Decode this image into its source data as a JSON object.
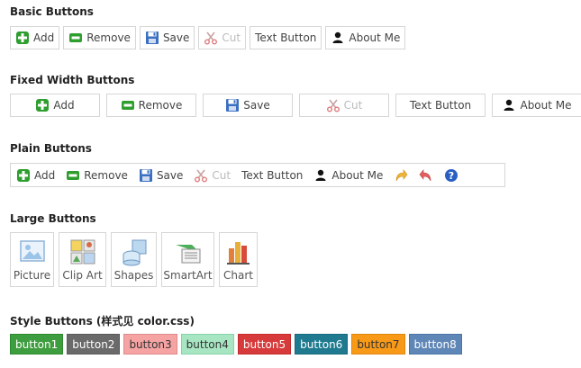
{
  "sections": {
    "basic": "Basic Buttons",
    "fixed": "Fixed Width Buttons",
    "plain": "Plain Buttons",
    "large": "Large Buttons",
    "style": "Style Buttons (样式见 color.css)"
  },
  "buttons": {
    "add": "Add",
    "remove": "Remove",
    "save": "Save",
    "cut": "Cut",
    "text": "Text Button",
    "about": "About Me"
  },
  "large": {
    "picture": "Picture",
    "clipart": "Clip Art",
    "shapes": "Shapes",
    "smartart": "SmartArt",
    "chart": "Chart"
  },
  "style_buttons": [
    {
      "label": "button1",
      "bg": "#3e9d3e",
      "fg": "#ffffff",
      "border": "#2f8a2f"
    },
    {
      "label": "button2",
      "bg": "#6a6a6a",
      "fg": "#ffffff",
      "border": "#5a5a5a"
    },
    {
      "label": "button3",
      "bg": "#f5a3a3",
      "fg": "#333333",
      "border": "#e08a8a"
    },
    {
      "label": "button4",
      "bg": "#a8e6c3",
      "fg": "#333333",
      "border": "#86d3a8"
    },
    {
      "label": "button5",
      "bg": "#d63a3a",
      "fg": "#ffffff",
      "border": "#c42d2d"
    },
    {
      "label": "button6",
      "bg": "#1f7a8f",
      "fg": "#ffffff",
      "border": "#166a7e"
    },
    {
      "label": "button7",
      "bg": "#f89a18",
      "fg": "#333333",
      "border": "#e08510"
    },
    {
      "label": "button8",
      "bg": "#5e86b6",
      "fg": "#ffffff",
      "border": "#4d74a3"
    }
  ]
}
